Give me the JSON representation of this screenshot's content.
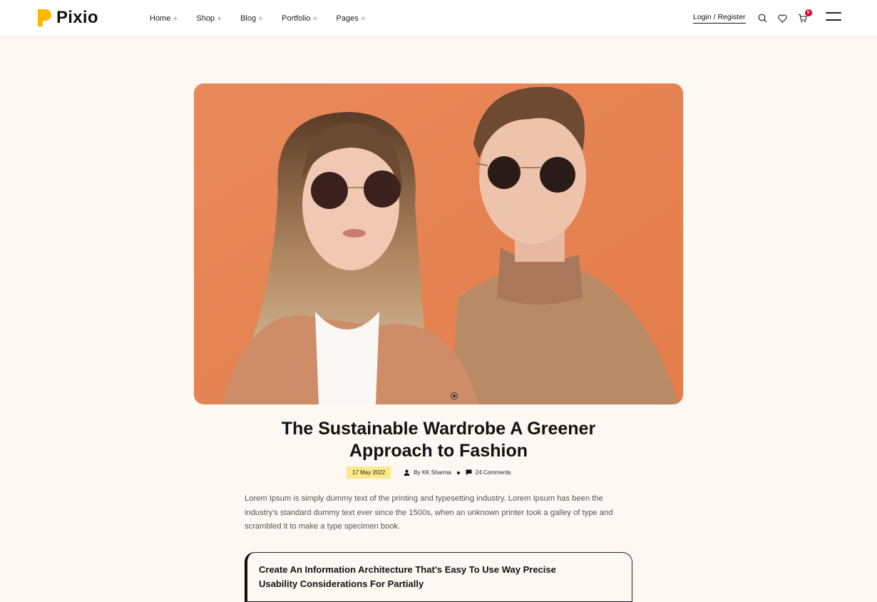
{
  "brand": {
    "name": "Pixio",
    "accent": "#ffb800"
  },
  "nav": {
    "items": [
      {
        "label": "Home"
      },
      {
        "label": "Shop"
      },
      {
        "label": "Blog"
      },
      {
        "label": "Portfolio"
      },
      {
        "label": "Pages"
      }
    ],
    "expand_symbol": "+"
  },
  "header_tools": {
    "login_label": "Login / Register",
    "icons": [
      "search-icon",
      "heart-icon",
      "cart-icon",
      "menu-icon"
    ],
    "cart_count": "5"
  },
  "post": {
    "hero_image": "two models in sunglasses and tan jackets on orange background",
    "title": "The Sustainable Wardrobe A Greener Approach to Fashion",
    "date": "17 May 2022",
    "author_prefix": "By",
    "author": "KK Sharma",
    "comments": "24 Comments",
    "body": "Lorem Ipsum is simply dummy text of the printing and typesetting industry. Lorem Ipsum has been the industry's standard dummy text ever since the 1500s, when an unknown printer took a galley of type and scrambled it to make a type specimen book.",
    "quote": "Create An Information Architecture That’s Easy To Use Way Precise Usability Considerations For Partially"
  },
  "colors": {
    "page_bg": "#fdf8f1",
    "date_badge": "#fde88a",
    "cart_badge": "#e8002d",
    "hero_bg": "#e8875a"
  }
}
